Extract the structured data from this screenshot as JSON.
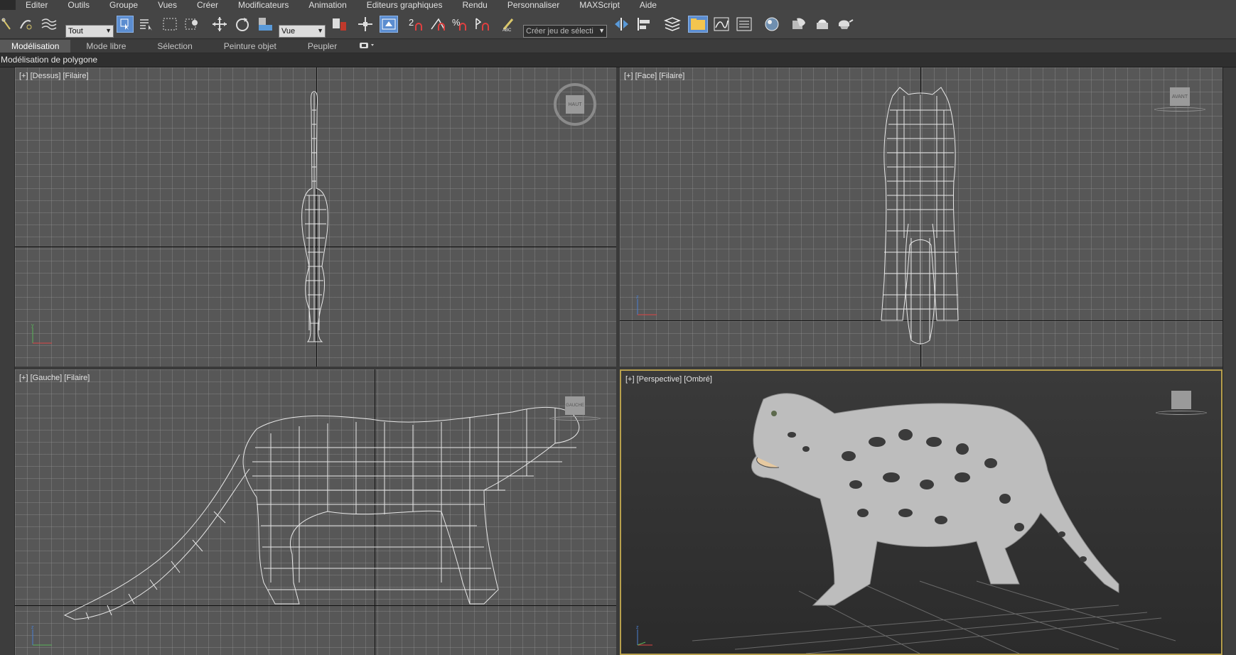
{
  "menu": [
    "Editer",
    "Outils",
    "Groupe",
    "Vues",
    "Créer",
    "Modificateurs",
    "Animation",
    "Editeurs graphiques",
    "Rendu",
    "Personnaliser",
    "MAXScript",
    "Aide"
  ],
  "toolbar": {
    "selection_filter": "Tout",
    "ref_coord": "Vue",
    "named_selection_placeholder": "Créer jeu de sélecti"
  },
  "ribbon": {
    "tabs": [
      "Modélisation",
      "Mode libre",
      "Sélection",
      "Peinture objet",
      "Peupler"
    ],
    "active_tab": "Modélisation",
    "panel_label": "Modélisation de polygone"
  },
  "viewports": {
    "top": {
      "label": "[+] [Dessus] [Filaire]",
      "cube": "HAUT"
    },
    "front": {
      "label": "[+] [Face] [Filaire]",
      "cube": "AVANT"
    },
    "left": {
      "label": "[+] [Gauche] [Filaire]",
      "cube": "GAUCHE"
    },
    "persp": {
      "label": "[+] [Perspective] [Ombré]",
      "cube": ""
    }
  },
  "colors": {
    "active_border": "#b7a04d",
    "pressed_button": "#5b8dd0",
    "viewport_bg": "#575757"
  }
}
